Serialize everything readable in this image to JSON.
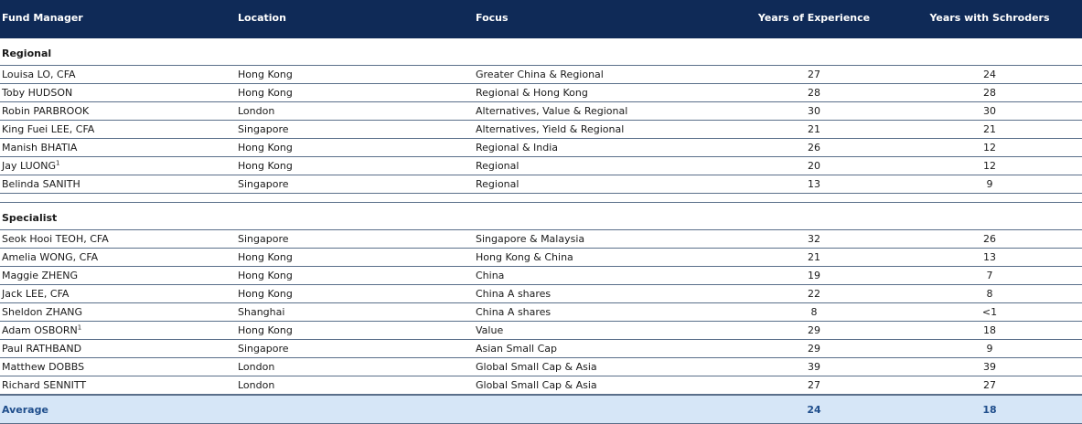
{
  "header": {
    "manager": "Fund Manager",
    "location": "Location",
    "focus": "Focus",
    "experience": "Years of Experience",
    "schroders": "Years with Schroders"
  },
  "sections": [
    {
      "title": "Regional",
      "rows": [
        {
          "name": "Louisa LO, CFA",
          "sup": "",
          "location": "Hong Kong",
          "focus": "Greater China & Regional",
          "experience": "27",
          "schroders": "24"
        },
        {
          "name": "Toby HUDSON",
          "sup": "",
          "location": "Hong Kong",
          "focus": "Regional & Hong Kong",
          "experience": "28",
          "schroders": "28"
        },
        {
          "name": "Robin PARBROOK",
          "sup": "",
          "location": "London",
          "focus": "Alternatives, Value & Regional",
          "experience": "30",
          "schroders": "30"
        },
        {
          "name": "King Fuei LEE,  CFA",
          "sup": "",
          "location": "Singapore",
          "focus": "Alternatives, Yield & Regional",
          "experience": "21",
          "schroders": "21"
        },
        {
          "name": "Manish BHATIA",
          "sup": "",
          "location": "Hong Kong",
          "focus": "Regional & India",
          "experience": "26",
          "schroders": "12"
        },
        {
          "name": "Jay LUONG",
          "sup": "1",
          "location": "Hong Kong",
          "focus": "Regional",
          "experience": "20",
          "schroders": "12"
        },
        {
          "name": "Belinda SANITH",
          "sup": "",
          "location": "Singapore",
          "focus": "Regional",
          "experience": "13",
          "schroders": "9"
        }
      ]
    },
    {
      "title": "Specialist",
      "rows": [
        {
          "name": "Seok Hooi TEOH,  CFA",
          "sup": "",
          "location": "Singapore",
          "focus": "Singapore & Malaysia",
          "experience": "32",
          "schroders": "26"
        },
        {
          "name": "Amelia WONG, CFA",
          "sup": "",
          "location": "Hong Kong",
          "focus": "Hong Kong & China",
          "experience": "21",
          "schroders": "13"
        },
        {
          "name": "Maggie ZHENG",
          "sup": "",
          "location": "Hong Kong",
          "focus": "China",
          "experience": "19",
          "schroders": "7"
        },
        {
          "name": "Jack LEE,  CFA",
          "sup": "",
          "location": "Hong Kong",
          "focus": "China A shares",
          "experience": "22",
          "schroders": "8"
        },
        {
          "name": "Sheldon ZHANG",
          "sup": "",
          "location": "Shanghai",
          "focus": "China A shares",
          "experience": "8",
          "schroders": "<1"
        },
        {
          "name": "Adam OSBORN",
          "sup": "1",
          "location": "Hong Kong",
          "focus": "Value",
          "experience": "29",
          "schroders": "18"
        },
        {
          "name": "Paul RATHBAND",
          "sup": "",
          "location": "Singapore",
          "focus": "Asian Small Cap",
          "experience": "29",
          "schroders": "9"
        },
        {
          "name": "Matthew  DOBBS",
          "sup": "",
          "location": "London",
          "focus": "Global Small Cap & Asia",
          "experience": "39",
          "schroders": "39"
        },
        {
          "name": "Richard SENNITT",
          "sup": "",
          "location": "London",
          "focus": "Global Small Cap & Asia",
          "experience": "27",
          "schroders": "27"
        }
      ]
    }
  ],
  "average": {
    "label": "Average",
    "experience": "24",
    "schroders": "18"
  },
  "colors": {
    "header_bg": "#0f2a57",
    "average_bg": "#d6e6f7",
    "average_text": "#1f4e8c"
  }
}
